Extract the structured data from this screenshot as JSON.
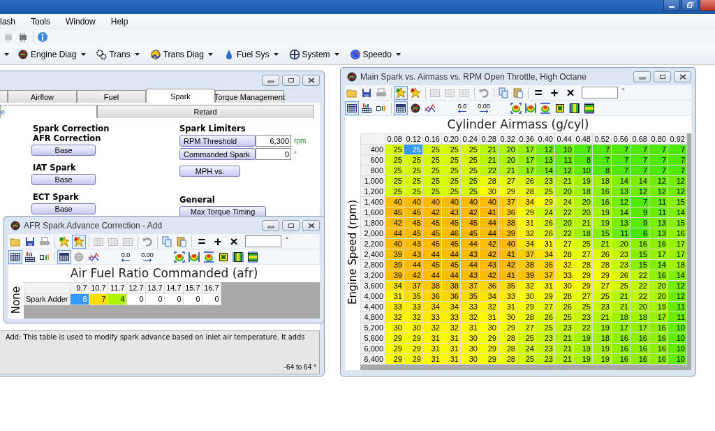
{
  "menu": [
    {
      "label": "lash"
    },
    {
      "label": "Tools"
    },
    {
      "label": "Window"
    },
    {
      "label": "Help"
    }
  ],
  "quick_toolbar": [
    {
      "kind": "chip",
      "disabled": true
    },
    {
      "kind": "chip",
      "disabled": false
    },
    {
      "kind": "sep"
    },
    {
      "kind": "info",
      "disabled": false
    }
  ],
  "nav_toolbar": [
    {
      "kind": "more"
    },
    {
      "kind": "engine",
      "label": "Engine Diag"
    },
    {
      "kind": "gears",
      "label": "Trans"
    },
    {
      "kind": "gear-diag",
      "label": "Trans Diag"
    },
    {
      "kind": "drop",
      "label": "Fuel Sys"
    },
    {
      "kind": "fan",
      "label": "System"
    },
    {
      "kind": "gauge",
      "label": "Speedo"
    }
  ],
  "editor": {
    "tabs": [
      {
        "label": "Airflow",
        "selected": false
      },
      {
        "label": "Fuel",
        "selected": false
      },
      {
        "label": "Spark",
        "selected": true
      },
      {
        "label": "Torque Management",
        "selected": false
      }
    ],
    "subtabs": [
      {
        "label": "e",
        "selected": true
      },
      {
        "label": "Retard",
        "selected": false
      }
    ],
    "spark_correction": {
      "heading": "Spark Correction",
      "groups": [
        {
          "label": "AFR Correction",
          "button": "Base"
        },
        {
          "label": "IAT Spark",
          "button": "Base"
        },
        {
          "label": "ECT Spark",
          "button": "Base"
        }
      ]
    },
    "spark_limiters": {
      "heading": "Spark Limiters",
      "fields": [
        {
          "label": "RPM Threshold",
          "value": "6,300",
          "unit": "rpm"
        },
        {
          "label": "Commanded Spark",
          "value": "0",
          "unit": "°"
        }
      ],
      "button": "MPH vs."
    },
    "general": {
      "heading": "General",
      "button": "Max Torque Timing"
    },
    "description": "Add: This table is used to modify spark advance based on inlet air temperature. It adds",
    "range": "-64 to 64 °"
  },
  "afr_window": {
    "title": "AFR Spark Advance Correction - Add",
    "toolbar1": [
      {
        "kind": "folder",
        "pressed": false
      },
      {
        "kind": "save",
        "pressed": false
      },
      {
        "kind": "print",
        "pressed": false
      },
      {
        "kind": "sep"
      },
      {
        "kind": "star-add",
        "pressed": false
      },
      {
        "kind": "star",
        "pressed": true
      },
      {
        "kind": "sep"
      },
      {
        "kind": "grid-disabled",
        "pressed": false
      },
      {
        "kind": "grid-disabled",
        "pressed": false
      },
      {
        "kind": "grid-disabled",
        "pressed": false
      },
      {
        "kind": "sep"
      },
      {
        "kind": "undo",
        "pressed": false
      },
      {
        "kind": "sep"
      },
      {
        "kind": "copy",
        "pressed": false
      },
      {
        "kind": "paste",
        "pressed": false
      },
      {
        "kind": "sep"
      },
      {
        "kind": "equals",
        "label": "=",
        "pressed": false
      },
      {
        "kind": "plus",
        "label": "+",
        "pressed": false
      },
      {
        "kind": "times",
        "label": "×",
        "pressed": false
      }
    ],
    "toolbar2": [
      {
        "kind": "grid",
        "pressed": true
      },
      {
        "kind": "bar-grid",
        "pressed": false
      },
      {
        "kind": "mini-bars",
        "pressed": false
      },
      {
        "kind": "sep"
      },
      {
        "kind": "table",
        "pressed": true
      },
      {
        "kind": "engine-grey",
        "pressed": false
      },
      {
        "kind": "line-chart",
        "pressed": false
      },
      {
        "kind": "gap"
      },
      {
        "kind": "decimal-left",
        "label": "0.0",
        "pressed": false
      },
      {
        "kind": "decimal-right",
        "label": "0.00",
        "pressed": false
      },
      {
        "kind": "gap"
      },
      {
        "kind": "surface-fit",
        "pressed": false
      },
      {
        "kind": "surface-side",
        "pressed": false
      },
      {
        "kind": "surface-top",
        "pressed": false
      },
      {
        "kind": "box-fit",
        "pressed": false
      },
      {
        "kind": "bars-v",
        "pressed": false
      },
      {
        "kind": "bars-h",
        "pressed": false
      }
    ],
    "unit": "°",
    "axis_title": "Air Fuel Ratio Commanded (afr)",
    "row_axis": "None",
    "zero_blank": true,
    "columns": [
      "9.7",
      "10.7",
      "11.7",
      "12.7",
      "13.7",
      "14.7",
      "15.7",
      "16.7"
    ],
    "rows": [
      {
        "label": "Spark Adder",
        "cells": [
          "8",
          "7",
          "4",
          "0",
          "0",
          "0",
          "0",
          "0"
        ],
        "selected": [
          true,
          false,
          false,
          false,
          false,
          false,
          false,
          false
        ]
      }
    ]
  },
  "main_window": {
    "title": "Main Spark vs. Airmass vs. RPM Open Throttle, High Octane",
    "toolbar1": [
      {
        "kind": "folder",
        "pressed": false
      },
      {
        "kind": "save",
        "pressed": false
      },
      {
        "kind": "print",
        "pressed": false
      },
      {
        "kind": "sep"
      },
      {
        "kind": "star-add",
        "pressed": true
      },
      {
        "kind": "star",
        "pressed": false
      },
      {
        "kind": "sep"
      },
      {
        "kind": "grid-disabled",
        "pressed": false
      },
      {
        "kind": "grid-disabled",
        "pressed": false
      },
      {
        "kind": "grid-disabled",
        "pressed": false
      },
      {
        "kind": "sep"
      },
      {
        "kind": "undo",
        "pressed": false
      },
      {
        "kind": "sep"
      },
      {
        "kind": "copy",
        "pressed": false
      },
      {
        "kind": "paste",
        "pressed": false
      },
      {
        "kind": "sep"
      },
      {
        "kind": "equals",
        "label": "=",
        "pressed": false
      },
      {
        "kind": "plus",
        "label": "+",
        "pressed": false
      },
      {
        "kind": "times",
        "label": "×",
        "pressed": false
      }
    ],
    "toolbar2": [
      {
        "kind": "grid",
        "pressed": true
      },
      {
        "kind": "bar-grid",
        "pressed": false
      },
      {
        "kind": "mini-bars",
        "pressed": false
      },
      {
        "kind": "sep"
      },
      {
        "kind": "table",
        "pressed": true
      },
      {
        "kind": "engine",
        "pressed": false
      },
      {
        "kind": "line-chart",
        "pressed": false
      },
      {
        "kind": "gap"
      },
      {
        "kind": "decimal-left",
        "label": "0.0",
        "pressed": false
      },
      {
        "kind": "decimal-right",
        "label": "0.00",
        "pressed": false
      },
      {
        "kind": "gap"
      },
      {
        "kind": "surface-fit",
        "pressed": false
      },
      {
        "kind": "surface-side",
        "pressed": false
      },
      {
        "kind": "surface-top",
        "pressed": false
      },
      {
        "kind": "box-fit",
        "pressed": false
      },
      {
        "kind": "bars-v",
        "pressed": false
      },
      {
        "kind": "bars-h",
        "pressed": false
      }
    ],
    "unit": "°",
    "axis_title": "Cylinder Airmass (g/cyl)",
    "row_axis": "Engine Speed (rpm)",
    "columns": [
      "0.08",
      "0.12",
      "0.16",
      "0.20",
      "0.24",
      "0.28",
      "0.32",
      "0.36",
      "0.40",
      "0.44",
      "0.48",
      "0.52",
      "0.56",
      "0.68",
      "0.80",
      "0.92"
    ],
    "rows": [
      {
        "label": "400",
        "cells": [
          "25",
          "25",
          "25",
          "25",
          "25",
          "21",
          "20",
          "17",
          "12",
          "10",
          "7",
          "7",
          "7",
          "7",
          "7",
          "7"
        ],
        "selected": [
          false,
          true,
          false,
          false,
          false,
          false,
          false,
          false,
          false,
          false,
          false,
          false,
          false,
          false,
          false,
          false
        ]
      },
      {
        "label": "600",
        "cells": [
          "25",
          "25",
          "25",
          "25",
          "25",
          "21",
          "20",
          "17",
          "13",
          "11",
          "8",
          "7",
          "7",
          "7",
          "7",
          "7"
        ],
        "selected": [
          false,
          false,
          false,
          false,
          false,
          false,
          false,
          false,
          false,
          false,
          false,
          false,
          false,
          false,
          false,
          false
        ]
      },
      {
        "label": "800",
        "cells": [
          "25",
          "25",
          "25",
          "25",
          "25",
          "22",
          "21",
          "17",
          "14",
          "12",
          "10",
          "8",
          "7",
          "7",
          "7",
          "7"
        ],
        "selected": [
          false,
          false,
          false,
          false,
          false,
          false,
          false,
          false,
          false,
          false,
          false,
          false,
          false,
          false,
          false,
          false
        ]
      },
      {
        "label": "1,000",
        "cells": [
          "25",
          "25",
          "25",
          "25",
          "25",
          "28",
          "27",
          "26",
          "23",
          "21",
          "19",
          "18",
          "14",
          "14",
          "12",
          "12"
        ],
        "selected": [
          false,
          false,
          false,
          false,
          false,
          false,
          false,
          false,
          false,
          false,
          false,
          false,
          false,
          false,
          false,
          false
        ]
      },
      {
        "label": "1,200",
        "cells": [
          "25",
          "25",
          "25",
          "25",
          "25",
          "30",
          "29",
          "28",
          "25",
          "20",
          "18",
          "16",
          "13",
          "12",
          "12",
          "12"
        ],
        "selected": [
          false,
          false,
          false,
          false,
          false,
          false,
          false,
          false,
          false,
          false,
          false,
          false,
          false,
          false,
          false,
          false
        ]
      },
      {
        "label": "1,400",
        "cells": [
          "40",
          "40",
          "40",
          "40",
          "40",
          "40",
          "37",
          "34",
          "29",
          "24",
          "20",
          "16",
          "12",
          "7",
          "11",
          "15"
        ],
        "selected": [
          false,
          false,
          false,
          false,
          false,
          false,
          false,
          false,
          false,
          false,
          false,
          false,
          false,
          false,
          false,
          false
        ]
      },
      {
        "label": "1,600",
        "cells": [
          "45",
          "45",
          "42",
          "43",
          "42",
          "41",
          "36",
          "29",
          "24",
          "22",
          "20",
          "19",
          "14",
          "9",
          "11",
          "14"
        ],
        "selected": [
          false,
          false,
          false,
          false,
          false,
          false,
          false,
          false,
          false,
          false,
          false,
          false,
          false,
          false,
          false,
          false
        ]
      },
      {
        "label": "1,800",
        "cells": [
          "42",
          "45",
          "45",
          "45",
          "45",
          "44",
          "38",
          "31",
          "26",
          "20",
          "21",
          "19",
          "13",
          "9",
          "13",
          "15"
        ],
        "selected": [
          false,
          false,
          false,
          false,
          false,
          false,
          false,
          false,
          false,
          false,
          false,
          false,
          false,
          false,
          false,
          false
        ]
      },
      {
        "label": "2,000",
        "cells": [
          "44",
          "45",
          "45",
          "46",
          "45",
          "44",
          "39",
          "32",
          "26",
          "22",
          "18",
          "15",
          "11",
          "6",
          "13",
          "16"
        ],
        "selected": [
          false,
          false,
          false,
          false,
          false,
          false,
          false,
          false,
          false,
          false,
          false,
          false,
          false,
          false,
          false,
          false
        ]
      },
      {
        "label": "2,200",
        "cells": [
          "40",
          "43",
          "45",
          "45",
          "44",
          "42",
          "40",
          "34",
          "31",
          "27",
          "25",
          "21",
          "20",
          "16",
          "16",
          "17"
        ],
        "selected": [
          false,
          false,
          false,
          false,
          false,
          false,
          false,
          false,
          false,
          false,
          false,
          false,
          false,
          false,
          false,
          false
        ]
      },
      {
        "label": "2,400",
        "cells": [
          "39",
          "43",
          "44",
          "44",
          "43",
          "42",
          "41",
          "37",
          "34",
          "28",
          "27",
          "26",
          "23",
          "15",
          "17",
          "17"
        ],
        "selected": [
          false,
          false,
          false,
          false,
          false,
          false,
          false,
          false,
          false,
          false,
          false,
          false,
          false,
          false,
          false,
          false
        ]
      },
      {
        "label": "2,800",
        "cells": [
          "39",
          "44",
          "45",
          "45",
          "44",
          "43",
          "42",
          "38",
          "36",
          "32",
          "28",
          "28",
          "23",
          "15",
          "14",
          "18"
        ],
        "selected": [
          false,
          false,
          false,
          false,
          false,
          false,
          false,
          false,
          false,
          false,
          false,
          false,
          false,
          false,
          false,
          false
        ]
      },
      {
        "label": "3,200",
        "cells": [
          "39",
          "42",
          "44",
          "44",
          "43",
          "42",
          "41",
          "39",
          "37",
          "33",
          "29",
          "29",
          "26",
          "22",
          "16",
          "14"
        ],
        "selected": [
          false,
          false,
          false,
          false,
          false,
          false,
          false,
          false,
          false,
          false,
          false,
          false,
          false,
          false,
          false,
          false
        ]
      },
      {
        "label": "3,600",
        "cells": [
          "34",
          "37",
          "38",
          "38",
          "37",
          "36",
          "35",
          "32",
          "31",
          "30",
          "29",
          "27",
          "25",
          "22",
          "20",
          "12"
        ],
        "selected": [
          false,
          false,
          false,
          false,
          false,
          false,
          false,
          false,
          false,
          false,
          false,
          false,
          false,
          false,
          false,
          false
        ]
      },
      {
        "label": "4,000",
        "cells": [
          "31",
          "35",
          "36",
          "36",
          "35",
          "34",
          "33",
          "30",
          "29",
          "28",
          "27",
          "25",
          "21",
          "22",
          "20",
          "12"
        ],
        "selected": [
          false,
          false,
          false,
          false,
          false,
          false,
          false,
          false,
          false,
          false,
          false,
          false,
          false,
          false,
          false,
          false
        ]
      },
      {
        "label": "4,400",
        "cells": [
          "33",
          "33",
          "34",
          "34",
          "33",
          "32",
          "31",
          "29",
          "27",
          "26",
          "25",
          "23",
          "21",
          "20",
          "19",
          "11"
        ],
        "selected": [
          false,
          false,
          false,
          false,
          false,
          false,
          false,
          false,
          false,
          false,
          false,
          false,
          false,
          false,
          false,
          false
        ]
      },
      {
        "label": "4,800",
        "cells": [
          "32",
          "32",
          "33",
          "33",
          "32",
          "31",
          "30",
          "28",
          "26",
          "25",
          "23",
          "21",
          "18",
          "18",
          "17",
          "11"
        ],
        "selected": [
          false,
          false,
          false,
          false,
          false,
          false,
          false,
          false,
          false,
          false,
          false,
          false,
          false,
          false,
          false,
          false
        ]
      },
      {
        "label": "5,200",
        "cells": [
          "30",
          "30",
          "32",
          "32",
          "31",
          "30",
          "29",
          "27",
          "25",
          "23",
          "22",
          "19",
          "17",
          "17",
          "16",
          "10"
        ],
        "selected": [
          false,
          false,
          false,
          false,
          false,
          false,
          false,
          false,
          false,
          false,
          false,
          false,
          false,
          false,
          false,
          false
        ]
      },
      {
        "label": "5,600",
        "cells": [
          "29",
          "29",
          "31",
          "31",
          "30",
          "29",
          "28",
          "25",
          "23",
          "21",
          "19",
          "18",
          "16",
          "16",
          "16",
          "10"
        ],
        "selected": [
          false,
          false,
          false,
          false,
          false,
          false,
          false,
          false,
          false,
          false,
          false,
          false,
          false,
          false,
          false,
          false
        ]
      },
      {
        "label": "6,000",
        "cells": [
          "29",
          "29",
          "31",
          "31",
          "30",
          "29",
          "28",
          "24",
          "23",
          "21",
          "19",
          "19",
          "16",
          "16",
          "16",
          "10"
        ],
        "selected": [
          false,
          false,
          false,
          false,
          false,
          false,
          false,
          false,
          false,
          false,
          false,
          false,
          false,
          false,
          false,
          false
        ]
      },
      {
        "label": "6,400",
        "cells": [
          "29",
          "29",
          "31",
          "31",
          "30",
          "29",
          "28",
          "25",
          "23",
          "21",
          "19",
          "19",
          "16",
          "16",
          "16",
          "10"
        ],
        "selected": [
          false,
          false,
          false,
          false,
          false,
          false,
          false,
          false,
          false,
          false,
          false,
          false,
          false,
          false,
          false,
          false
        ]
      }
    ]
  }
}
